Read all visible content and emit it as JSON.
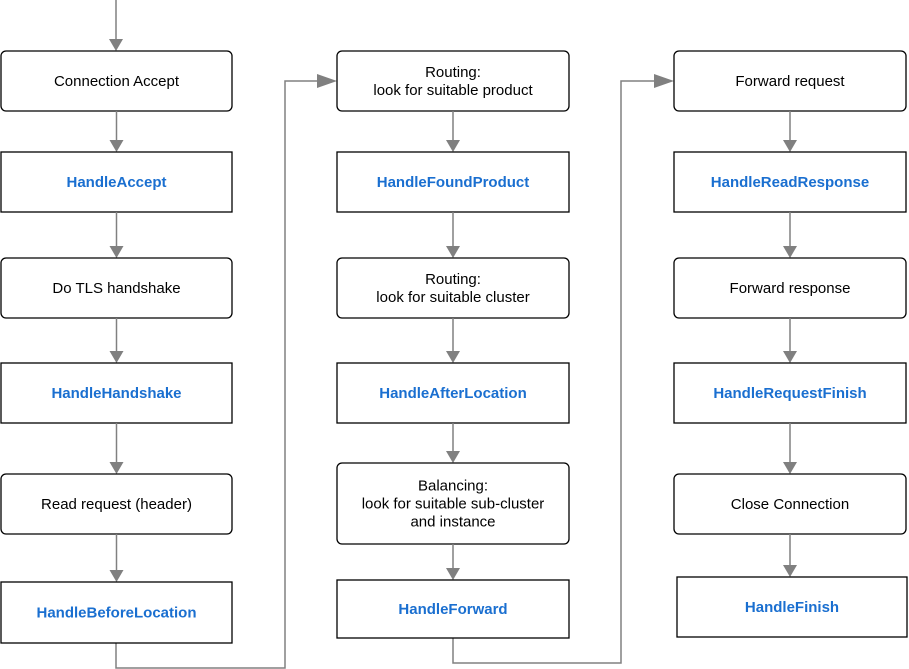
{
  "colors": {
    "handler_text": "#1a6fd0",
    "connector": "#808080"
  },
  "columns": [
    {
      "steps": [
        {
          "lines": [
            "Connection Accept"
          ],
          "kind": "step"
        },
        {
          "lines": [
            "HandleAccept"
          ],
          "kind": "handler"
        },
        {
          "lines": [
            "Do TLS handshake"
          ],
          "kind": "step"
        },
        {
          "lines": [
            "HandleHandshake"
          ],
          "kind": "handler"
        },
        {
          "lines": [
            "Read request (header)"
          ],
          "kind": "step"
        },
        {
          "lines": [
            "HandleBeforeLocation"
          ],
          "kind": "handler"
        }
      ]
    },
    {
      "steps": [
        {
          "lines": [
            "Routing:",
            "look for suitable product"
          ],
          "kind": "step"
        },
        {
          "lines": [
            "HandleFoundProduct"
          ],
          "kind": "handler"
        },
        {
          "lines": [
            "Routing:",
            "look for suitable cluster"
          ],
          "kind": "step"
        },
        {
          "lines": [
            "HandleAfterLocation"
          ],
          "kind": "handler"
        },
        {
          "lines": [
            "Balancing:",
            "look for suitable sub-cluster",
            "and instance"
          ],
          "kind": "step"
        },
        {
          "lines": [
            "HandleForward"
          ],
          "kind": "handler"
        }
      ]
    },
    {
      "steps": [
        {
          "lines": [
            "Forward request"
          ],
          "kind": "step"
        },
        {
          "lines": [
            "HandleReadResponse"
          ],
          "kind": "handler"
        },
        {
          "lines": [
            "Forward response"
          ],
          "kind": "step"
        },
        {
          "lines": [
            "HandleRequestFinish"
          ],
          "kind": "handler"
        },
        {
          "lines": [
            "Close Connection"
          ],
          "kind": "step"
        },
        {
          "lines": [
            "HandleFinish"
          ],
          "kind": "handler"
        }
      ]
    }
  ]
}
